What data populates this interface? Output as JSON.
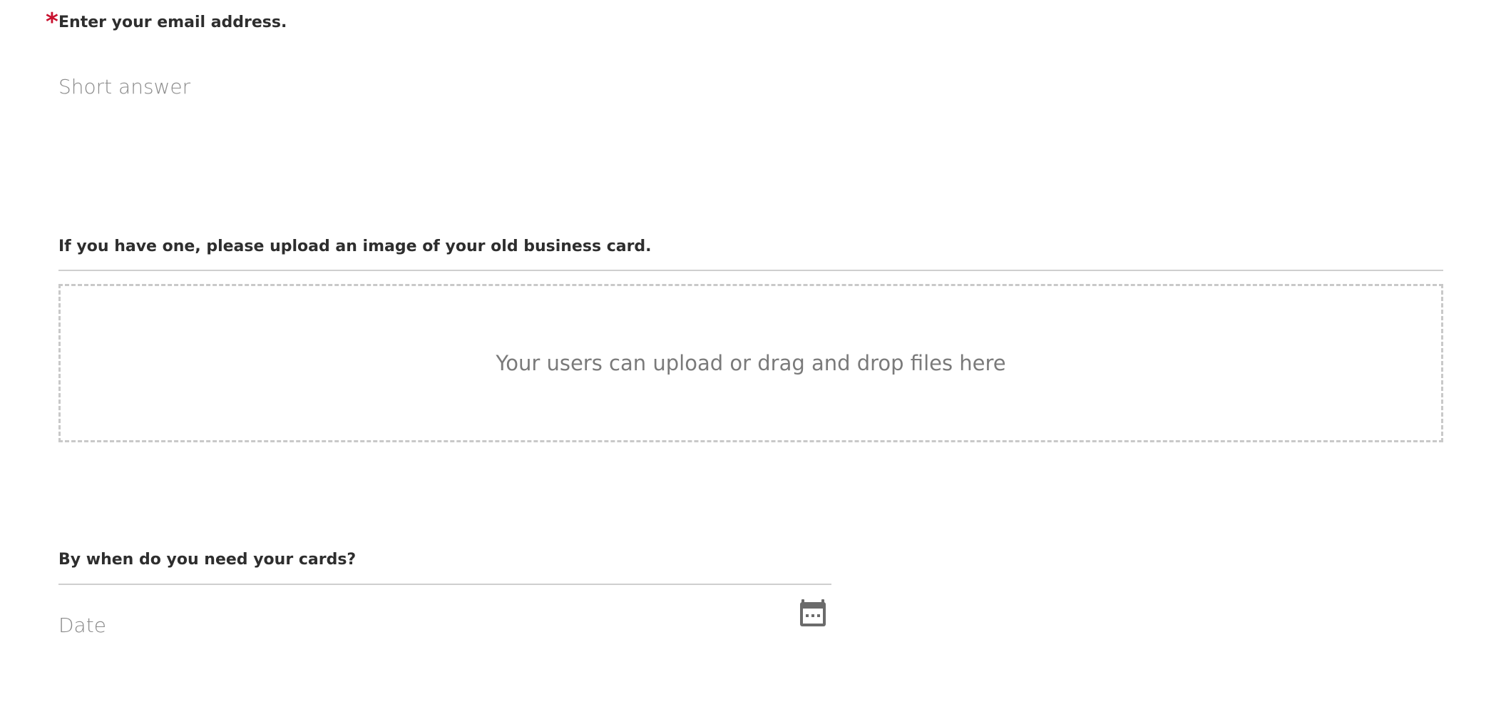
{
  "email_field": {
    "required_marker": "*",
    "label": "Enter your email address.",
    "placeholder": "Short answer"
  },
  "upload_field": {
    "label": "If you have one, please upload an image of your old business card.",
    "dropzone_text": "Your users can upload or drag and drop files here"
  },
  "date_field": {
    "label": "By when do you need your cards?",
    "placeholder": "Date",
    "icon": "calendar-icon"
  },
  "colors": {
    "required": "#c8102e",
    "label": "#2e2e2e",
    "placeholder": "#8a8a8a",
    "border": "#cfcfcf",
    "icon": "#6b6b6b"
  }
}
